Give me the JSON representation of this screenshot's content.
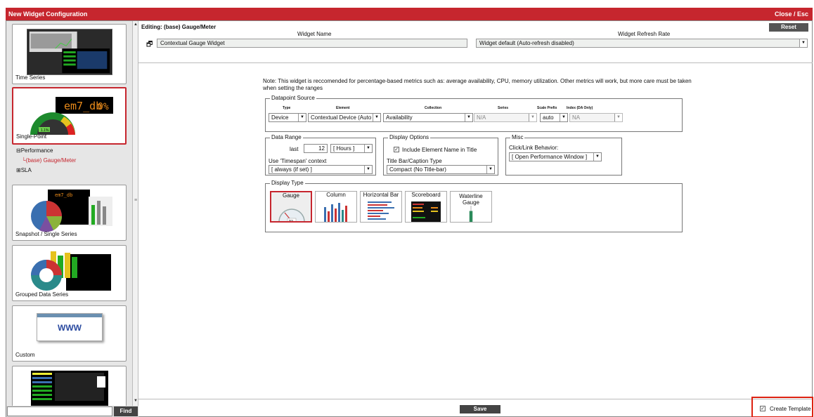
{
  "window": {
    "title": "New Widget Configuration",
    "close_label": "Close / Esc"
  },
  "sidebar": {
    "cards": [
      {
        "label": "Time Series"
      },
      {
        "label": "Single-Point",
        "thumb_text": "em7_db",
        "thumb_pct": "0%",
        "gauge_value": "1.1%"
      },
      {
        "label": "Snapshot / Single Series"
      },
      {
        "label": "Grouped Data Series"
      },
      {
        "label": "Custom",
        "thumb_text": "WWW"
      },
      {
        "label": ""
      }
    ],
    "tree": [
      {
        "label": "Performance",
        "prefix": "⊟"
      },
      {
        "label": "(base) Gauge/Meter",
        "prefix": "└"
      },
      {
        "label": "SLA",
        "prefix": "⊞"
      }
    ],
    "find_button": "Find",
    "find_value": ""
  },
  "editor": {
    "editing_label": "Editing: (base) Gauge/Meter",
    "reset_label": "Reset",
    "widget_name_header": "Widget Name",
    "widget_name_value": "Contextual Gauge Widget",
    "refresh_header": "Widget Refresh Rate",
    "refresh_value": "Widget default (Auto-refresh disabled)",
    "note": "Note: This widget is reccomended for percentage-based metrics such as: average availability, CPU, memory utilization. Other metrics will work, but more care must be taken when setting the ranges"
  },
  "datapoint": {
    "legend": "Datapoint Source",
    "type_label": "Type",
    "type_value": "Device",
    "element_label": "Element",
    "element_value": "Contextual Device (Auto",
    "collection_label": "Collection",
    "collection_value": "Availability",
    "series_label": "Series",
    "series_value": "N/A",
    "scale_label": "Scale Prefix",
    "scale_value": "auto",
    "index_label": "Index (DA Only)",
    "index_value": "NA"
  },
  "data_range": {
    "legend": "Data Range",
    "last_label": "last",
    "last_value": "12",
    "unit_value": "[ Hours ]",
    "timespan_label": "Use 'Timespan' context",
    "timespan_value": "[ always (if set) ]"
  },
  "display_options": {
    "legend": "Display Options",
    "include_label": "Include Element Name in Title",
    "include_checked": true,
    "caption_label": "Title Bar/Caption Type",
    "caption_value": "Compact (No Title-bar)"
  },
  "misc": {
    "legend": "Misc",
    "click_label": "Click/Link Behavior:",
    "click_value": "[ Open Performance Window ]"
  },
  "display_type": {
    "legend": "Display Type",
    "options": [
      {
        "label": "Gauge",
        "gauge_value": "50%"
      },
      {
        "label": "Column"
      },
      {
        "label": "Horizontal Bar"
      },
      {
        "label": "Scoreboard"
      },
      {
        "label": "Waterline Gauge"
      }
    ]
  },
  "footer": {
    "save_label": "Save",
    "create_template_label": "Create Template",
    "create_template_checked": true
  }
}
